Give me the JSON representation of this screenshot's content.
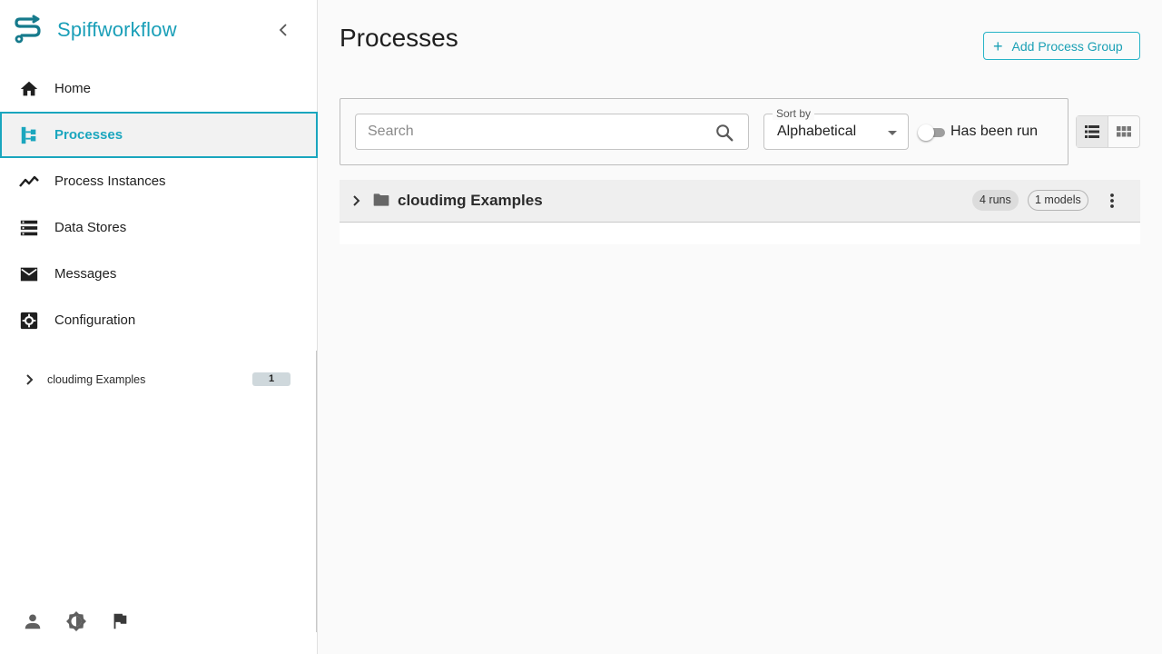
{
  "app": {
    "name": "Spiffworkflow",
    "brand_color": "#1a9fb8"
  },
  "sidebar": {
    "collapse_icon": "chevron-left-icon",
    "nav": [
      {
        "label": "Home",
        "icon": "home-icon",
        "active": false
      },
      {
        "label": "Processes",
        "icon": "process-tree-icon",
        "active": true
      },
      {
        "label": "Process Instances",
        "icon": "trend-line-icon",
        "active": false
      },
      {
        "label": "Data Stores",
        "icon": "data-store-icon",
        "active": false
      },
      {
        "label": "Messages",
        "icon": "mail-icon",
        "active": false
      },
      {
        "label": "Configuration",
        "icon": "settings-icon",
        "active": false
      }
    ],
    "tree": [
      {
        "label": "cloudimg Examples",
        "count": "1"
      }
    ],
    "footer_icons": [
      "user-icon",
      "brightness-icon",
      "flag-icon"
    ]
  },
  "main": {
    "title": "Processes",
    "add_group_button": "Add Process Group",
    "search": {
      "placeholder": "Search",
      "value": ""
    },
    "sort": {
      "label": "Sort by",
      "value": "Alphabetical"
    },
    "toggle": {
      "label": "Has been run",
      "on": false
    },
    "view_modes": [
      "list-view-icon",
      "grid-view-icon"
    ],
    "groups": [
      {
        "name": "cloudimg Examples",
        "runs": "4 runs",
        "models": "1 models"
      }
    ]
  }
}
